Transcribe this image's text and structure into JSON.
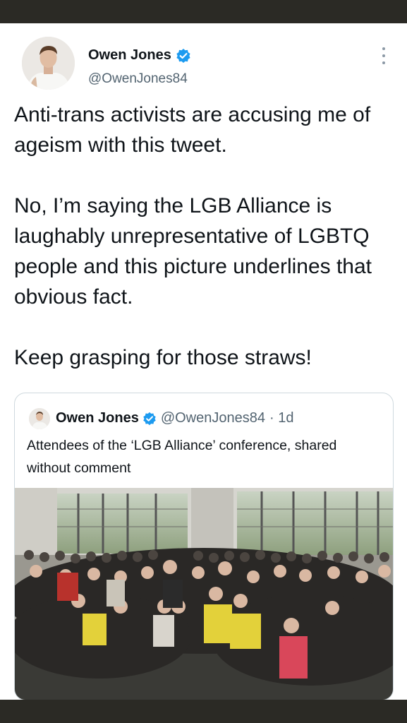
{
  "tweet": {
    "author_name": "Owen Jones",
    "author_handle": "@OwenJones84",
    "paragraphs": [
      "Anti-trans activists are accusing me of ageism with this tweet.",
      "No, I’m saying the LGB Alliance is laughably unrepresentative of LGBTQ people and this picture underlines that obvious fact.",
      "Keep grasping for those straws!"
    ]
  },
  "quoted_tweet": {
    "author_name": "Owen Jones",
    "author_handle": "@OwenJones84",
    "time": "· 1d",
    "text": "Attendees of the ‘LGB Alliance’ conference, shared without comment"
  },
  "icons": {
    "verified": "verified-badge-icon",
    "more": "more-options-icon"
  },
  "colors": {
    "verified_blue": "#1d9bf0",
    "secondary_text": "#536471",
    "primary_text": "#0f1419",
    "frame_dark": "#2b2a25"
  }
}
